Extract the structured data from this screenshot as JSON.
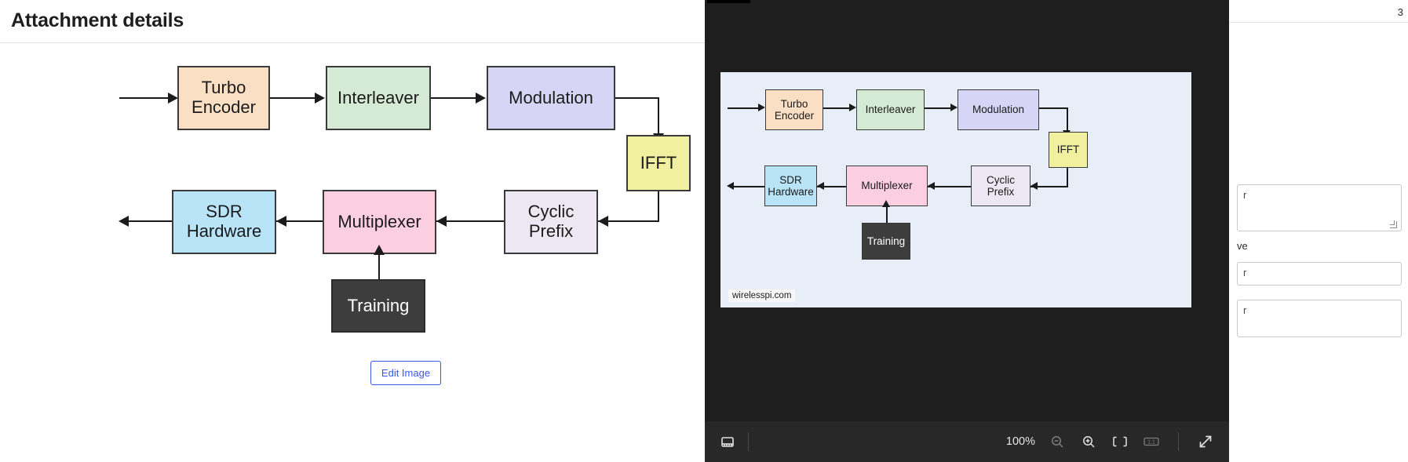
{
  "page": {
    "title": "Attachment details",
    "edit_image_label": "Edit Image"
  },
  "diagram": {
    "watermark": "wirelesspi.com",
    "nodes": [
      {
        "id": "turbo_encoder",
        "label": "Turbo\nEncoder",
        "color": "#fadfc5"
      },
      {
        "id": "interleaver",
        "label": "Interleaver",
        "color": "#d5ead5"
      },
      {
        "id": "modulation",
        "label": "Modulation",
        "color": "#d6d5f5"
      },
      {
        "id": "ifft",
        "label": "IFFT",
        "color": "#f0f0a0"
      },
      {
        "id": "cyclic_prefix",
        "label": "Cyclic\nPrefix",
        "color": "#ece7f2"
      },
      {
        "id": "multiplexer",
        "label": "Multiplexer",
        "color": "#fbcfe0"
      },
      {
        "id": "sdr_hardware",
        "label": "SDR\nHardware",
        "color": "#b9e4f7"
      },
      {
        "id": "training",
        "label": "Training",
        "color": "#3d3d3d"
      }
    ],
    "edges": [
      {
        "from": "input",
        "to": "turbo_encoder"
      },
      {
        "from": "turbo_encoder",
        "to": "interleaver"
      },
      {
        "from": "interleaver",
        "to": "modulation"
      },
      {
        "from": "modulation",
        "to": "ifft"
      },
      {
        "from": "ifft",
        "to": "cyclic_prefix"
      },
      {
        "from": "cyclic_prefix",
        "to": "multiplexer"
      },
      {
        "from": "multiplexer",
        "to": "sdr_hardware"
      },
      {
        "from": "training",
        "to": "multiplexer"
      },
      {
        "from": "sdr_hardware",
        "to": "output"
      }
    ]
  },
  "viewer": {
    "zoom_level": "100%",
    "toolbar": {
      "filmstrip_label": "filmstrip-icon",
      "zoom_out_label": "zoom-out-icon",
      "zoom_in_label": "zoom-in-icon",
      "fit_label": "fit-to-screen-icon",
      "actual_size_label": "1:1",
      "fullscreen_label": "expand-icon"
    }
  },
  "right_panel": {
    "top_number": "3",
    "field_1": "r",
    "label_save": "ve",
    "field_2": "r",
    "field_3": "r"
  }
}
